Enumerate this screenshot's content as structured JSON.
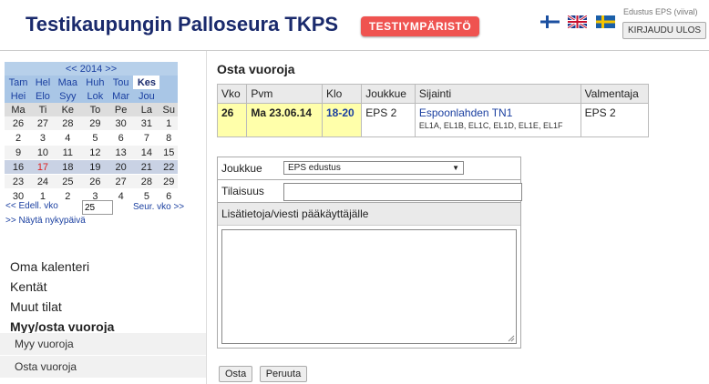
{
  "header": {
    "title": "Testikaupungin Palloseura TKPS",
    "test_badge": "TESTIYMPÄRISTÖ",
    "user_label": "Edustus EPS (viival)",
    "logout_label": "KIRJAUDU ULOS",
    "languages": [
      "fi",
      "en",
      "sv"
    ]
  },
  "calendar": {
    "year_nav": "<< 2014 >>",
    "months": [
      "Tam",
      "Hel",
      "Maa",
      "Huh",
      "Tou",
      "Kes",
      "Hei",
      "Elo",
      "Syy",
      "Lok",
      "Mar",
      "Jou"
    ],
    "selected_month": "Kes",
    "weekdays": [
      "Ma",
      "Ti",
      "Ke",
      "To",
      "Pe",
      "La",
      "Su"
    ],
    "weeks": [
      [
        "26",
        "27",
        "28",
        "29",
        "30",
        "31",
        "1"
      ],
      [
        "2",
        "3",
        "4",
        "5",
        "6",
        "7",
        "8"
      ],
      [
        "9",
        "10",
        "11",
        "12",
        "13",
        "14",
        "15"
      ],
      [
        "16",
        "17",
        "18",
        "19",
        "20",
        "21",
        "22"
      ],
      [
        "23",
        "24",
        "25",
        "26",
        "27",
        "28",
        "29"
      ],
      [
        "30",
        "1",
        "2",
        "3",
        "4",
        "5",
        "6"
      ]
    ],
    "prev_week": "<< Edell. vko",
    "week_value": "25",
    "next_week": "Seur. vko >>",
    "show_current": ">> Näytä nykypäivä"
  },
  "menu": {
    "items": [
      "Oma kalenteri",
      "Kentät",
      "Muut tilat",
      "Myy/osta vuoroja"
    ],
    "sub": [
      "Myy vuoroja",
      "Osta vuoroja"
    ]
  },
  "main": {
    "page_title": "Osta vuoroja",
    "table_headers": [
      "Vko",
      "Pvm",
      "Klo",
      "Joukkue",
      "Sijainti",
      "Valmentaja"
    ],
    "row": {
      "week": "26",
      "date": "Ma 23.06.14",
      "time": "18-20",
      "team": "EPS 2",
      "location": "Espoonlahden TN1",
      "fields": "EL1A, EL1B, EL1C, EL1D, EL1E, EL1F",
      "coach": "EPS 2"
    },
    "form": {
      "team_label": "Joukkue",
      "team_value": "EPS edustus",
      "booker_label": "Tilaisuus",
      "booker_value": "",
      "notes_label": "Lisätietoja/viesti pääkäyttäjälle",
      "buy_label": "Osta",
      "cancel_label": "Peruuta"
    }
  },
  "colors": {
    "accent": "#1a2a6c",
    "badge": "#ef5350",
    "highlight": "#ffffaa"
  }
}
